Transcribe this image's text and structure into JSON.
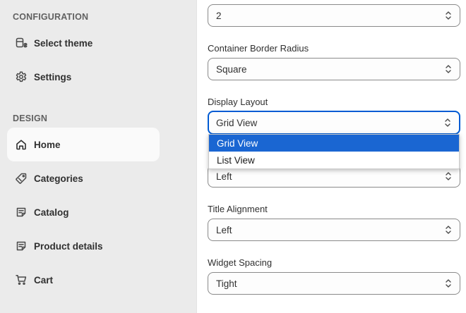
{
  "sidebar": {
    "sections": [
      {
        "heading": "CONFIGURATION",
        "items": [
          {
            "label": "Select theme",
            "icon": "theme-icon"
          },
          {
            "label": "Settings",
            "icon": "gear-icon"
          }
        ]
      },
      {
        "heading": "DESIGN",
        "items": [
          {
            "label": "Home",
            "icon": "home-icon",
            "active": true
          },
          {
            "label": "Categories",
            "icon": "tag-icon"
          },
          {
            "label": "Catalog",
            "icon": "catalog-icon"
          },
          {
            "label": "Product details",
            "icon": "product-details-icon"
          },
          {
            "label": "Cart",
            "icon": "cart-icon"
          }
        ]
      }
    ]
  },
  "form": {
    "fields": [
      {
        "label": "",
        "value": "2"
      },
      {
        "label": "Container Border Radius",
        "value": "Square"
      },
      {
        "label": "Display Layout",
        "value": "Grid View",
        "focused": true,
        "options": [
          "Grid View",
          "List View"
        ],
        "open": true
      },
      {
        "label": "",
        "value": "Left"
      },
      {
        "label": "Title Alignment",
        "value": "Left"
      },
      {
        "label": "Widget Spacing",
        "value": "Tight"
      }
    ]
  },
  "colors": {
    "sidebar_bg": "#ebebeb",
    "focus_border": "#005bd3",
    "dropdown_selected": "#1a66d2"
  }
}
